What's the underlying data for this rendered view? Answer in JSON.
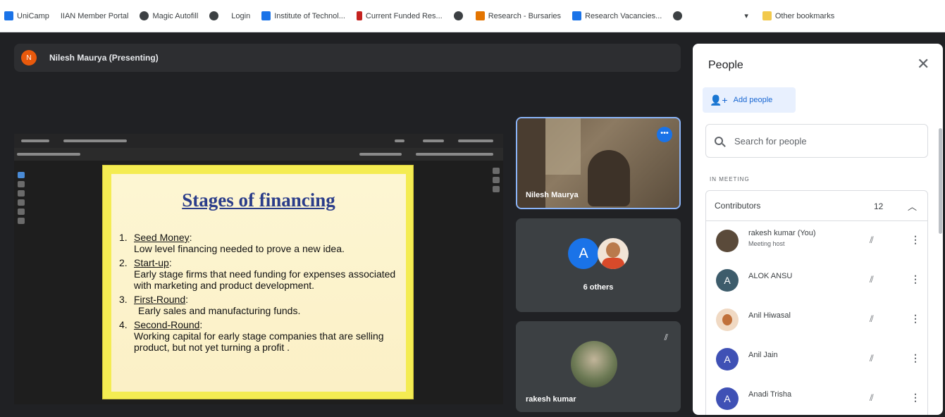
{
  "bookmarks": {
    "items": [
      {
        "label": "UniCamp",
        "color": "#1a73e8"
      },
      {
        "label": "IIAN Member Portal",
        "color": ""
      },
      {
        "label": "Magic Autofill",
        "color": "#3c4043"
      },
      {
        "label": "Login",
        "color": ""
      },
      {
        "label": "Institute of Technol...",
        "color": "#1a73e8"
      },
      {
        "label": "Current Funded Res...",
        "color": "#c5221f"
      },
      {
        "label": "Research - Bursaries",
        "color": "#e37400"
      },
      {
        "label": "Research Vacancies...",
        "color": "#1a73e8"
      }
    ],
    "other": "Other bookmarks"
  },
  "presenter": {
    "initial": "N",
    "label": "Nilesh Maurya (Presenting)"
  },
  "slide": {
    "title": "Stages of financing",
    "items": [
      {
        "num": "1.",
        "head": "Seed Money",
        "desc": "Low level financing needed to prove a new idea."
      },
      {
        "num": "2.",
        "head": "Start-up",
        "desc": "Early stage firms that need funding for expenses associated  with marketing and product development."
      },
      {
        "num": "3.",
        "head": "First-Round",
        "desc": "Early sales and manufacturing funds."
      },
      {
        "num": "4.",
        "head": "Second-Round",
        "desc": "Working capital for early stage companies that are selling product, but not yet turning a profit ."
      }
    ]
  },
  "tiles": {
    "main_name": "Nilesh Maurya",
    "others_initial": "A",
    "others_label": "6 others",
    "third_name": "rakesh kumar"
  },
  "panel": {
    "title": "People",
    "add_label": "Add people",
    "search_placeholder": "Search for people",
    "section": "IN MEETING",
    "group": "Contributors",
    "count": "12",
    "people": [
      {
        "name": "rakesh kumar (You)",
        "sub": "Meeting host",
        "initial": "",
        "color": "#5a4a3a"
      },
      {
        "name": "ALOK ANSU",
        "sub": "",
        "initial": "A",
        "color": "#3d5c6b"
      },
      {
        "name": "Anil Hiwasal",
        "sub": "",
        "initial": "",
        "color": "#c0703a"
      },
      {
        "name": "Anil Jain",
        "sub": "",
        "initial": "A",
        "color": "#3f51b5"
      },
      {
        "name": "Anadi Trisha",
        "sub": "",
        "initial": "A",
        "color": "#3f51b5"
      }
    ]
  }
}
